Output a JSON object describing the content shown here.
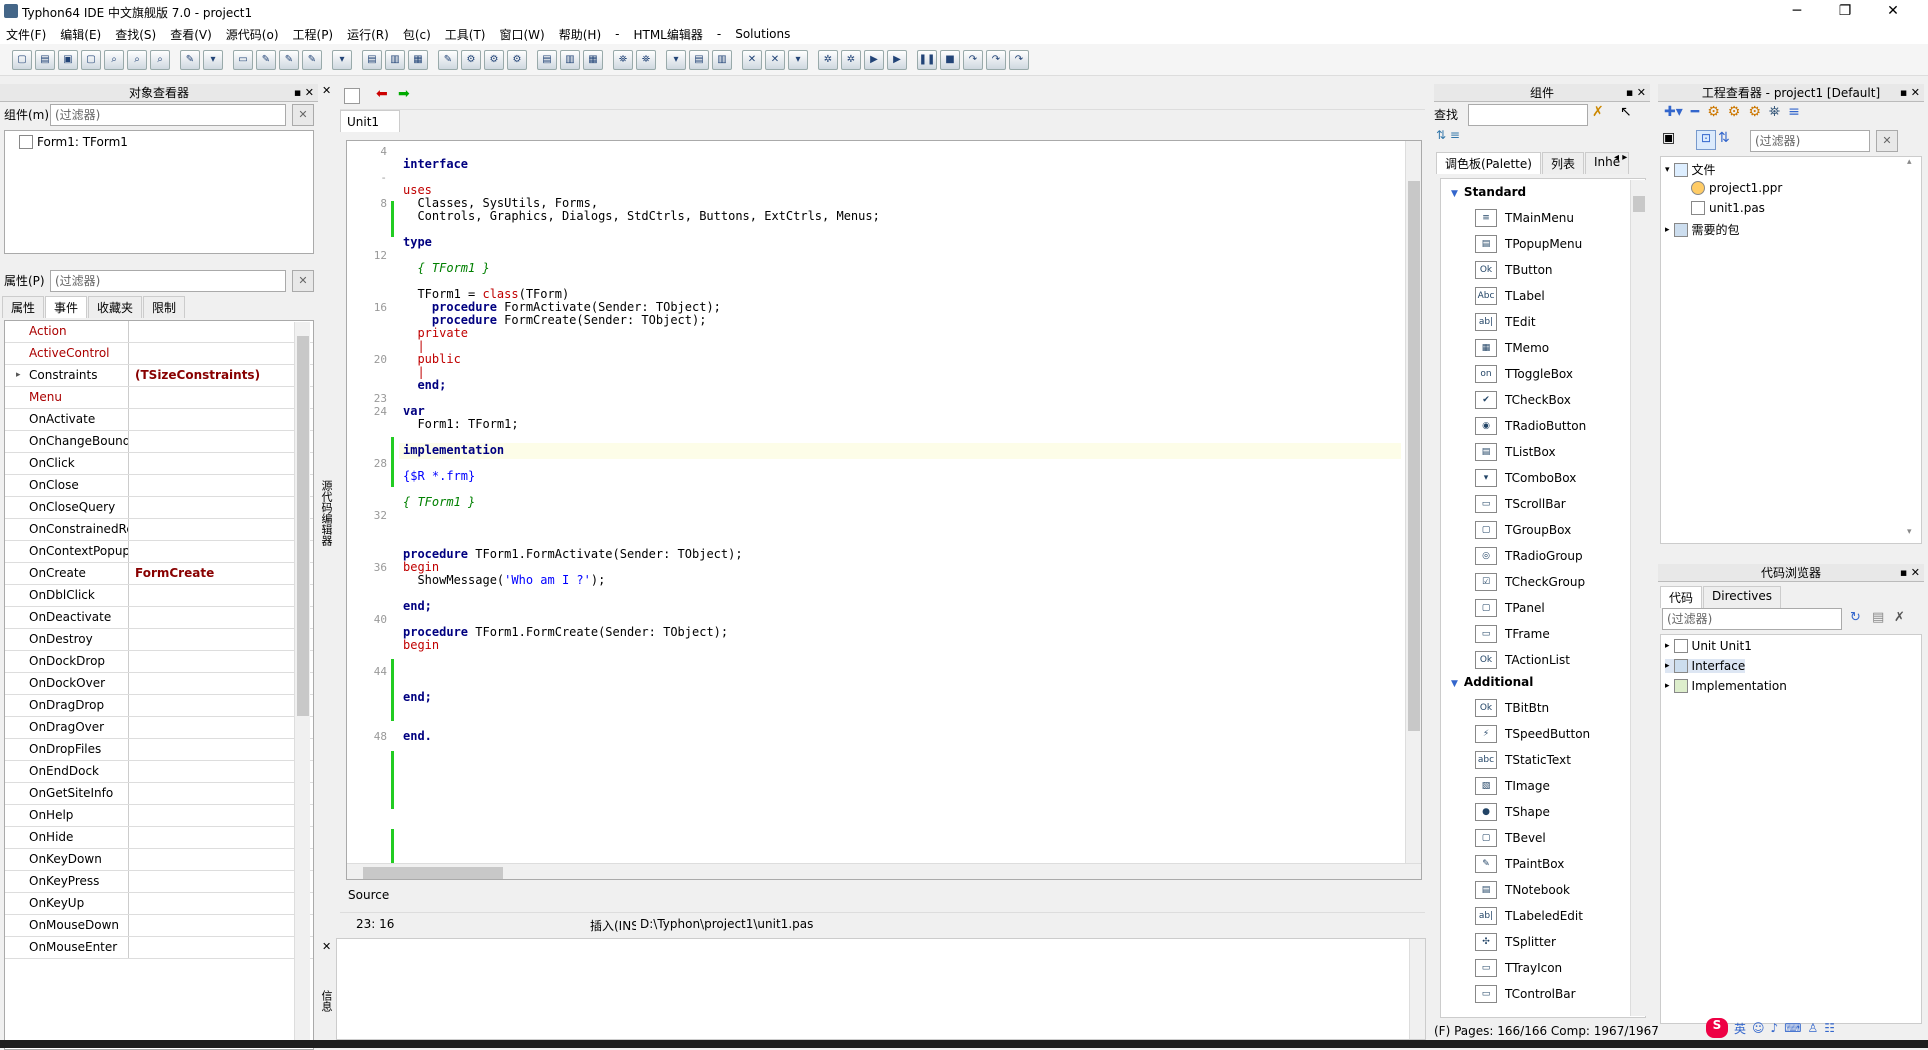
{
  "window": {
    "title": "Typhon64 IDE 中文旗舰版 7.0 - project1",
    "min": "─",
    "max": "❐",
    "close": "✕"
  },
  "menu": [
    "文件(F)",
    "编辑(E)",
    "查找(S)",
    "查看(V)",
    "源代码(o)",
    "工程(P)",
    "运行(R)",
    "包(c)",
    "工具(T)",
    "窗口(W)",
    "帮助(H)",
    "-",
    "HTML编辑器",
    "-",
    "Solutions"
  ],
  "object_inspector": {
    "title": "对象查看器",
    "comp_label": "组件(m)",
    "filter_placeholder": "(过滤器)",
    "tree_item": "Form1: TForm1",
    "props_label": "属性(P)",
    "tabs": [
      "属性",
      "事件",
      "收藏夹",
      "限制"
    ],
    "rows": [
      {
        "name": "Action",
        "value": "",
        "red": true
      },
      {
        "name": "ActiveControl",
        "value": "",
        "red": true
      },
      {
        "name": "Constraints",
        "value": "(TSizeConstraints)",
        "red": false,
        "expand": true
      },
      {
        "name": "Menu",
        "value": "",
        "red": true
      },
      {
        "name": "OnActivate",
        "value": ""
      },
      {
        "name": "OnChangeBounds",
        "value": ""
      },
      {
        "name": "OnClick",
        "value": ""
      },
      {
        "name": "OnClose",
        "value": ""
      },
      {
        "name": "OnCloseQuery",
        "value": ""
      },
      {
        "name": "OnConstrainedResize",
        "value": ""
      },
      {
        "name": "OnContextPopup",
        "value": ""
      },
      {
        "name": "OnCreate",
        "value": "FormCreate"
      },
      {
        "name": "OnDblClick",
        "value": ""
      },
      {
        "name": "OnDeactivate",
        "value": ""
      },
      {
        "name": "OnDestroy",
        "value": ""
      },
      {
        "name": "OnDockDrop",
        "value": ""
      },
      {
        "name": "OnDockOver",
        "value": ""
      },
      {
        "name": "OnDragDrop",
        "value": ""
      },
      {
        "name": "OnDragOver",
        "value": ""
      },
      {
        "name": "OnDropFiles",
        "value": ""
      },
      {
        "name": "OnEndDock",
        "value": ""
      },
      {
        "name": "OnGetSiteInfo",
        "value": ""
      },
      {
        "name": "OnHelp",
        "value": ""
      },
      {
        "name": "OnHide",
        "value": ""
      },
      {
        "name": "OnKeyDown",
        "value": ""
      },
      {
        "name": "OnKeyPress",
        "value": ""
      },
      {
        "name": "OnKeyUp",
        "value": ""
      },
      {
        "name": "OnMouseDown",
        "value": ""
      },
      {
        "name": "OnMouseEnter",
        "value": ""
      }
    ]
  },
  "editor": {
    "tab": "Unit1",
    "side_label": "源代码编辑器",
    "bottom_tab": "Source",
    "status_pos": "23:  16",
    "status_mode": "插入(INS)",
    "status_file": "D:\\Typhon\\project1\\unit1.pas",
    "msg_label": "信息",
    "lines": [
      {
        "n": "4",
        "t": ""
      },
      {
        "n": "",
        "t": "interface",
        "k": "kw"
      },
      {
        "n": "-",
        "t": ""
      },
      {
        "n": "",
        "t": "uses",
        "k": "kw2"
      },
      {
        "n": "8",
        "t": "  Classes, SysUtils, Forms,"
      },
      {
        "n": "",
        "t": "  Controls, Graphics, Dialogs, StdCtrls, Buttons, ExtCtrls, Menus;"
      },
      {
        "n": "",
        "t": ""
      },
      {
        "n": "",
        "t": "type",
        "k": "kw"
      },
      {
        "n": "12",
        "t": ""
      },
      {
        "n": "",
        "t": "  { TForm1 }",
        "k": "cm"
      },
      {
        "n": "",
        "t": ""
      },
      {
        "n": "",
        "t": "  TForm1 = class(TForm)",
        "k": "mixcls"
      },
      {
        "n": "16",
        "t": "    procedure FormActivate(Sender: TObject);",
        "k": "proc"
      },
      {
        "n": "",
        "t": "    procedure FormCreate(Sender: TObject);",
        "k": "proc"
      },
      {
        "n": "",
        "t": "  private",
        "k": "kw2"
      },
      {
        "n": "",
        "t": "  |",
        "k": "kw2"
      },
      {
        "n": "20",
        "t": "  public",
        "k": "kw2"
      },
      {
        "n": "",
        "t": "  |",
        "k": "kw2"
      },
      {
        "n": "",
        "t": "  end;",
        "k": "end"
      },
      {
        "n": "23",
        "t": ""
      },
      {
        "n": "24",
        "t": "var",
        "k": "kw"
      },
      {
        "n": "",
        "t": "  Form1: TForm1;"
      },
      {
        "n": "",
        "t": ""
      },
      {
        "n": "",
        "t": "implementation",
        "k": "kw"
      },
      {
        "n": "28",
        "t": ""
      },
      {
        "n": "",
        "t": "{$R *.frm}",
        "k": "str"
      },
      {
        "n": "",
        "t": ""
      },
      {
        "n": "",
        "t": "{ TForm1 }",
        "k": "cm"
      },
      {
        "n": "32",
        "t": ""
      },
      {
        "n": "",
        "t": ""
      },
      {
        "n": "",
        "t": ""
      },
      {
        "n": "",
        "t": "procedure TForm1.FormActivate(Sender: TObject);",
        "k": "proc"
      },
      {
        "n": "36",
        "t": "begin",
        "k": "kw2"
      },
      {
        "n": "",
        "t": "  ShowMessage('Who am I ?');",
        "k": "show"
      },
      {
        "n": "",
        "t": ""
      },
      {
        "n": "",
        "t": "end;",
        "k": "end"
      },
      {
        "n": "40",
        "t": ""
      },
      {
        "n": "",
        "t": "procedure TForm1.FormCreate(Sender: TObject);",
        "k": "proc"
      },
      {
        "n": "",
        "t": "begin",
        "k": "kw2"
      },
      {
        "n": "",
        "t": ""
      },
      {
        "n": "44",
        "t": ""
      },
      {
        "n": "",
        "t": ""
      },
      {
        "n": "",
        "t": "end;",
        "k": "end"
      },
      {
        "n": "",
        "t": ""
      },
      {
        "n": "",
        "t": ""
      },
      {
        "n": "48",
        "t": "end.",
        "k": "end"
      }
    ]
  },
  "palette": {
    "title": "组件",
    "search_label": "查找",
    "tabs": [
      "调色板(Palette)",
      "列表",
      "Inhe"
    ],
    "status": "(F) Pages: 166/166  Comp: 1967/1967",
    "cat1": "Standard",
    "items1": [
      [
        "TMainMenu",
        "≡"
      ],
      [
        "TPopupMenu",
        "▤"
      ],
      [
        "TButton",
        "Ok"
      ],
      [
        "TLabel",
        "Abc"
      ],
      [
        "TEdit",
        "ab|"
      ],
      [
        "TMemo",
        "▦"
      ],
      [
        "TToggleBox",
        "on"
      ],
      [
        "TCheckBox",
        "✔"
      ],
      [
        "TRadioButton",
        "◉"
      ],
      [
        "TListBox",
        "▤"
      ],
      [
        "TComboBox",
        "▾"
      ],
      [
        "TScrollBar",
        "▭"
      ],
      [
        "TGroupBox",
        "▢"
      ],
      [
        "TRadioGroup",
        "◎"
      ],
      [
        "TCheckGroup",
        "☑"
      ],
      [
        "TPanel",
        "▢"
      ],
      [
        "TFrame",
        "▭"
      ],
      [
        "TActionList",
        "Ok"
      ]
    ],
    "cat2": "Additional",
    "items2": [
      [
        "TBitBtn",
        "Ok"
      ],
      [
        "TSpeedButton",
        "⚡"
      ],
      [
        "TStaticText",
        "abc"
      ],
      [
        "TImage",
        "▧"
      ],
      [
        "TShape",
        "●"
      ],
      [
        "TBevel",
        "▢"
      ],
      [
        "TPaintBox",
        "✎"
      ],
      [
        "TNotebook",
        "▤"
      ],
      [
        "TLabeledEdit",
        "ab|"
      ],
      [
        "TSplitter",
        "✣"
      ],
      [
        "TTrayIcon",
        "▭"
      ],
      [
        "TControlBar",
        "▭"
      ]
    ]
  },
  "project": {
    "title": "工程查看器 - project1 [Default]",
    "filter_placeholder": "(过滤器)",
    "root": "文件",
    "files": [
      "project1.ppr",
      "unit1.pas"
    ],
    "packages": "需要的包"
  },
  "code_browser": {
    "title": "代码浏览器",
    "tabs": [
      "代码",
      "Directives"
    ],
    "filter_placeholder": "(过滤器)",
    "items": [
      "Unit Unit1",
      "Interface",
      "Implementation"
    ]
  },
  "tray": {
    "ime": "英"
  }
}
